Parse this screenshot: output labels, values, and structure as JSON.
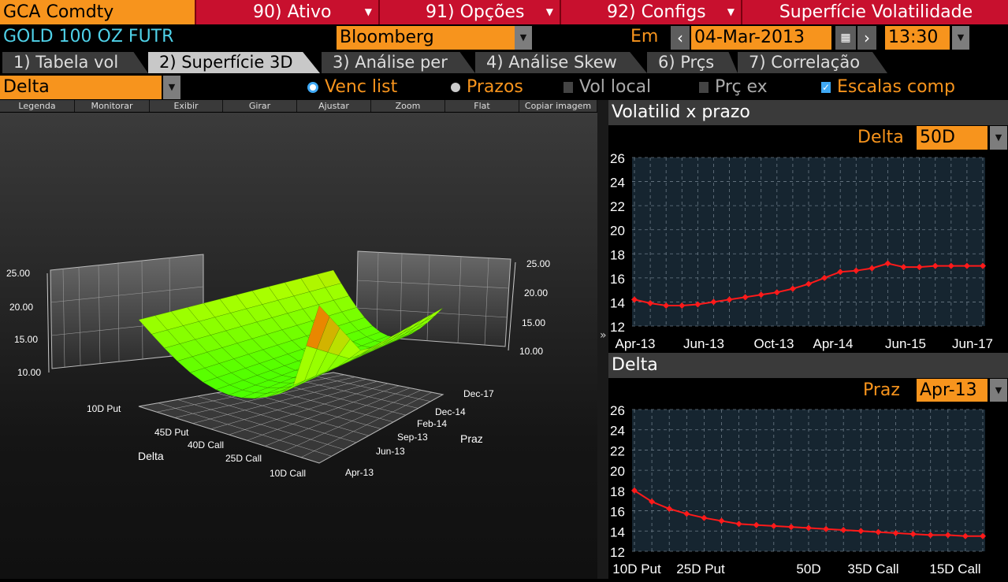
{
  "topbar": {
    "ticker": "GCA Comdty",
    "menu_ativo": "90) Ativo",
    "menu_opcoes": "91) Opções",
    "menu_configs": "92) Configs",
    "title": "Superfície Volatilidade"
  },
  "security": {
    "name": "GOLD 100 OZ FUTR",
    "source": "Bloomberg",
    "em_label": "Em",
    "date": "04-Mar-2013",
    "time": "13:30"
  },
  "tabs": [
    {
      "label": "1) Tabela vol"
    },
    {
      "label": "2) Superfície 3D"
    },
    {
      "label": "3) Análise per"
    },
    {
      "label": "4) Análise Skew"
    },
    {
      "label": "6) Prçs"
    },
    {
      "label": "7) Correlação"
    }
  ],
  "options": {
    "mode": "Delta",
    "venc_list": "Venc list",
    "prazos": "Prazos",
    "vol_local": "Vol local",
    "prc_ex": "Prç ex",
    "escalas_comp": "Escalas comp"
  },
  "toolbar": [
    "Legenda",
    "Monitorar",
    "Exibir",
    "Girar",
    "Ajustar",
    "Zoom",
    "Flat",
    "Copiar imagem"
  ],
  "surface": {
    "z_ticks_left": [
      "25.00",
      "20.00",
      "15.00",
      "10.00"
    ],
    "z_ticks_right": [
      "25.00",
      "20.00",
      "15.00",
      "10.00"
    ],
    "delta_axis_label": "Delta",
    "delta_ticks": [
      "10D Put",
      "45D Put",
      "40D Call",
      "25D Call",
      "10D Call"
    ],
    "term_axis_label": "Praz",
    "term_ticks": [
      "Dec-17",
      "Dec-14",
      "Feb-14",
      "Sep-13",
      "Jun-13",
      "Apr-13"
    ]
  },
  "colors": {
    "accent": "#f7941d",
    "series": "#ff1a1a",
    "surface_low": "#33ff00",
    "surface_high": "#ff3300"
  },
  "panel1": {
    "title": "Volatilid x prazo",
    "selector_label": "Delta",
    "selector_value": "50D"
  },
  "panel2": {
    "title": "Delta",
    "selector_label": "Praz",
    "selector_value": "Apr-13"
  },
  "chart_data": [
    {
      "type": "line",
      "ylim": [
        12,
        26
      ],
      "yticks": [
        "26",
        "24",
        "22",
        "20",
        "18",
        "16",
        "14",
        "12"
      ],
      "xtick_labels": [
        "Apr-13",
        "Jun-13",
        "Oct-13",
        "Apr-14",
        "Jun-15",
        "Jun-17"
      ],
      "grid": true,
      "series": [
        {
          "values": [
            14.2,
            13.9,
            13.7,
            13.7,
            13.8,
            14.0,
            14.2,
            14.4,
            14.6,
            14.8,
            15.1,
            15.5,
            16.0,
            16.5,
            16.6,
            16.8,
            17.2,
            16.9,
            16.9,
            17.0,
            17.0,
            17.0,
            17.0
          ]
        }
      ]
    },
    {
      "type": "line",
      "ylim": [
        12,
        26
      ],
      "yticks": [
        "26",
        "24",
        "22",
        "20",
        "18",
        "16",
        "14",
        "12"
      ],
      "xtick_labels": [
        "10D Put",
        "25D Put",
        "50D",
        "35D Call",
        "15D Call"
      ],
      "grid": true,
      "series": [
        {
          "values": [
            18.0,
            16.9,
            16.2,
            15.7,
            15.3,
            15.0,
            14.7,
            14.6,
            14.5,
            14.4,
            14.3,
            14.2,
            14.1,
            14.0,
            13.9,
            13.8,
            13.7,
            13.6,
            13.6,
            13.5,
            13.5
          ]
        }
      ]
    }
  ]
}
